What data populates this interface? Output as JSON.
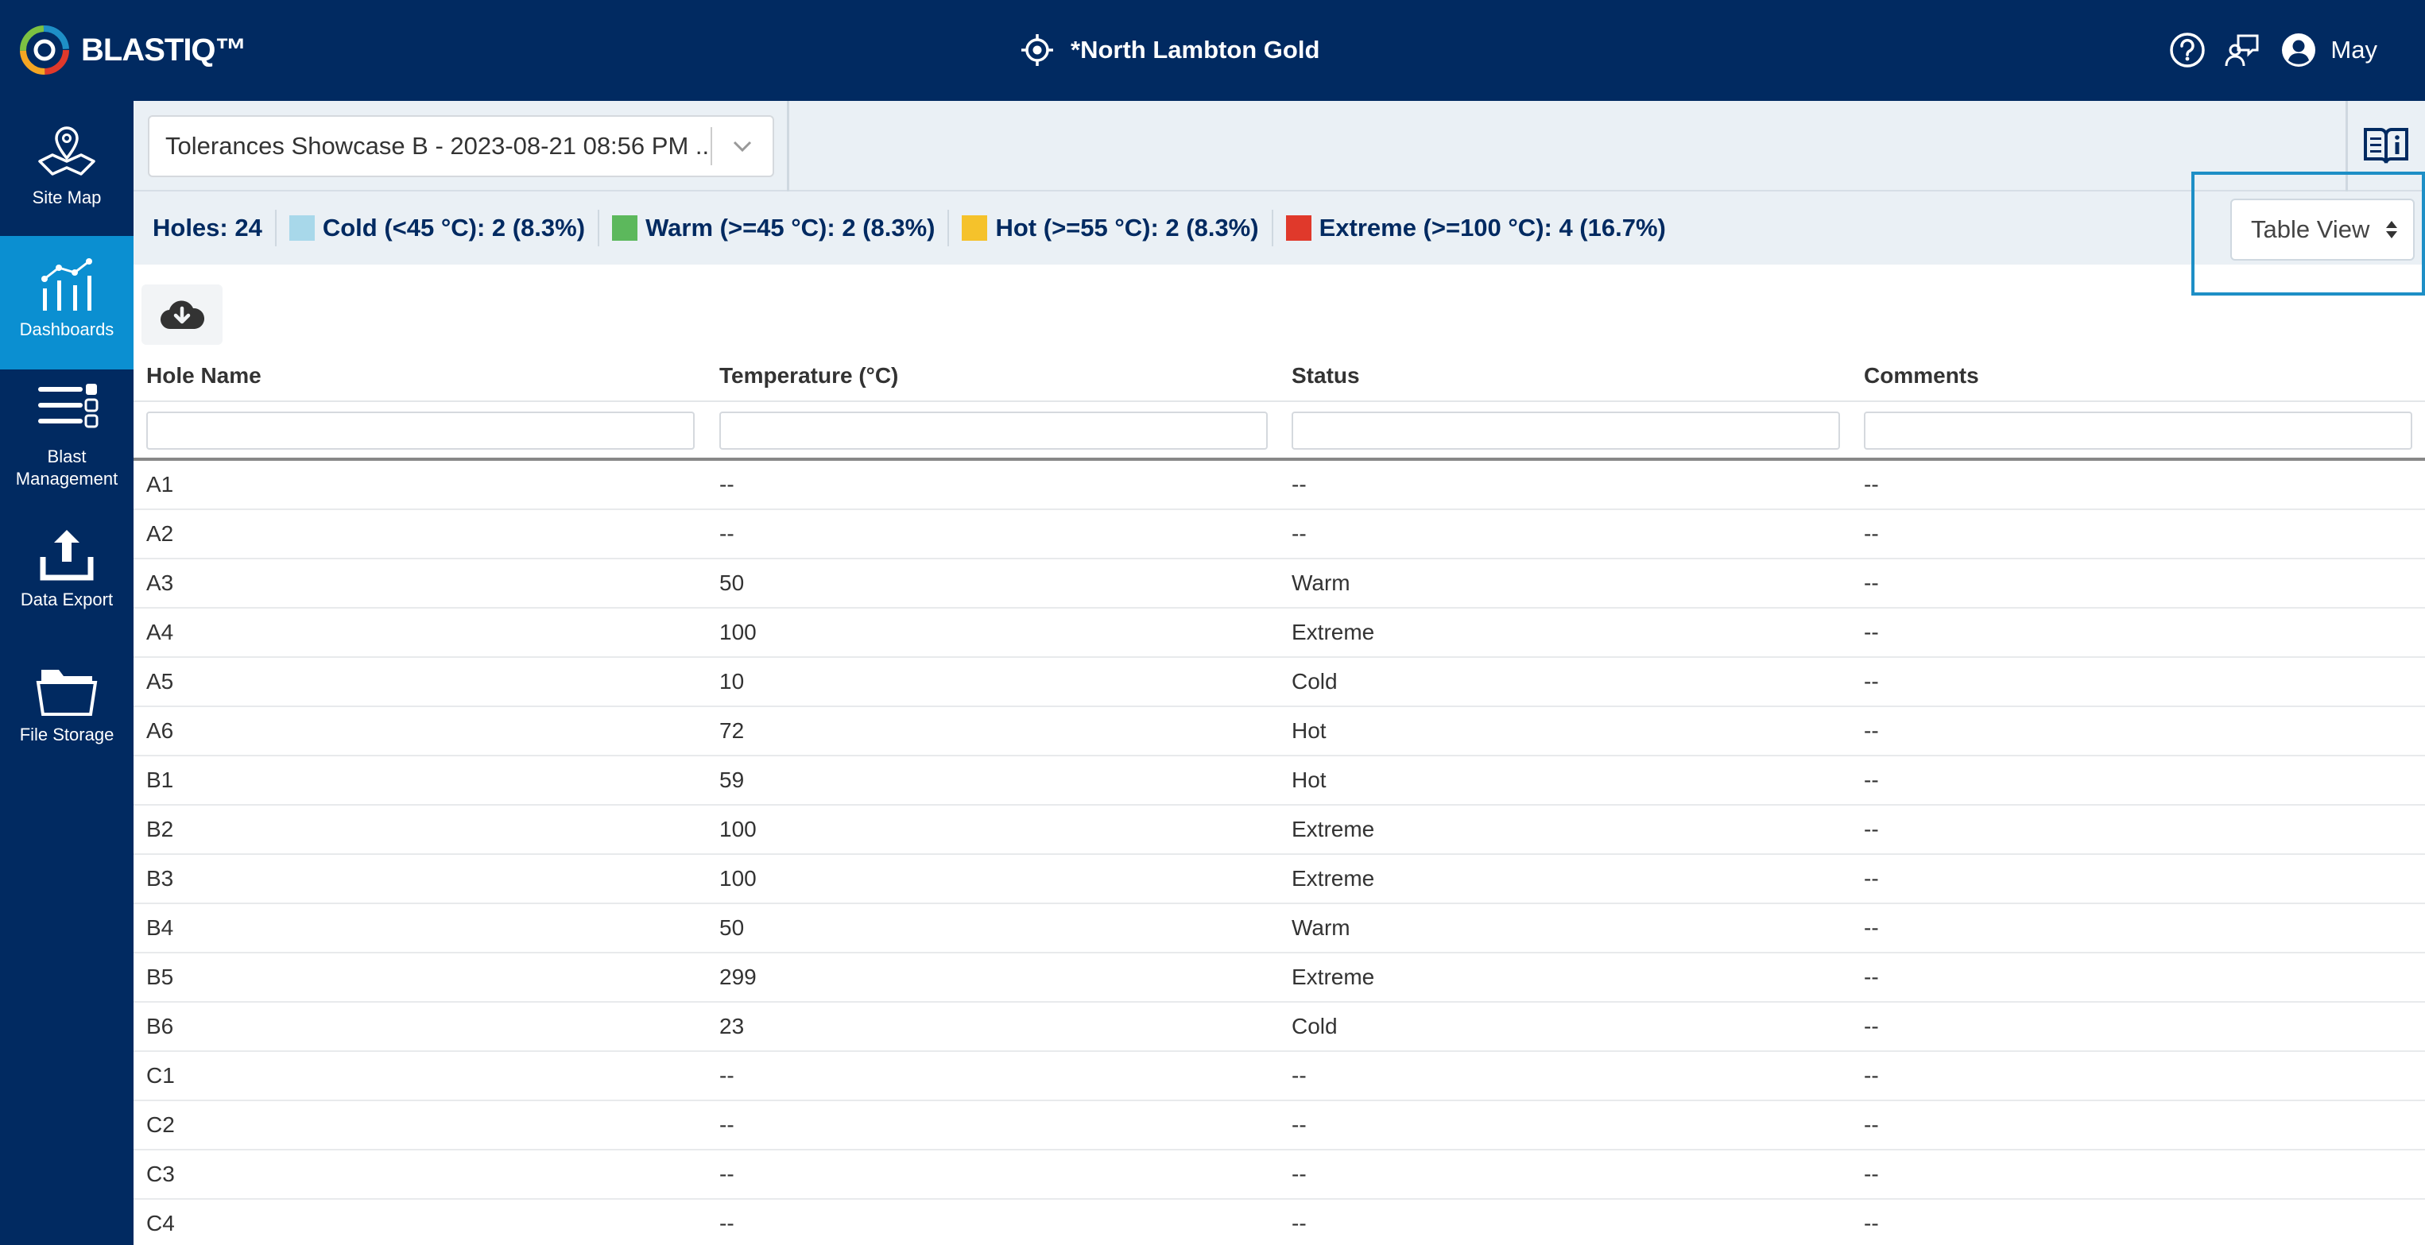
{
  "app": {
    "logo_text": "BLASTIQ™",
    "site_title": "*North Lambton Gold",
    "user_name": "May"
  },
  "sidebar": {
    "items": [
      {
        "label": "Site Map",
        "active": false
      },
      {
        "label": "Dashboards",
        "active": true
      },
      {
        "label": "Blast Management",
        "active": false
      },
      {
        "label": "Data Export",
        "active": false
      },
      {
        "label": "File Storage",
        "active": false
      }
    ]
  },
  "toolbar": {
    "blast_selected": "Tolerances Showcase B - 2023-08-21 08:56 PM ..."
  },
  "summary": {
    "holes": "Holes: 24",
    "cold": "Cold (<45 °C): 2 (8.3%)",
    "warm": "Warm (>=45 °C): 2 (8.3%)",
    "hot": "Hot (>=55 °C): 2 (8.3%)",
    "extreme": "Extreme (>=100 °C): 4 (16.7%)",
    "colors": {
      "cold": "#a8d8ea",
      "warm": "#5cb85c",
      "hot": "#f5c22b",
      "extreme": "#e0392b"
    }
  },
  "view_select": {
    "value": "Table View"
  },
  "table": {
    "headers": [
      "Hole Name",
      "Temperature (°C)",
      "Status",
      "Comments"
    ],
    "rows": [
      [
        "A1",
        "--",
        "--",
        "--"
      ],
      [
        "A2",
        "--",
        "--",
        "--"
      ],
      [
        "A3",
        "50",
        "Warm",
        "--"
      ],
      [
        "A4",
        "100",
        "Extreme",
        "--"
      ],
      [
        "A5",
        "10",
        "Cold",
        "--"
      ],
      [
        "A6",
        "72",
        "Hot",
        "--"
      ],
      [
        "B1",
        "59",
        "Hot",
        "--"
      ],
      [
        "B2",
        "100",
        "Extreme",
        "--"
      ],
      [
        "B3",
        "100",
        "Extreme",
        "--"
      ],
      [
        "B4",
        "50",
        "Warm",
        "--"
      ],
      [
        "B5",
        "299",
        "Extreme",
        "--"
      ],
      [
        "B6",
        "23",
        "Cold",
        "--"
      ],
      [
        "C1",
        "--",
        "--",
        "--"
      ],
      [
        "C2",
        "--",
        "--",
        "--"
      ],
      [
        "C3",
        "--",
        "--",
        "--"
      ],
      [
        "C4",
        "--",
        "--",
        "--"
      ]
    ]
  }
}
